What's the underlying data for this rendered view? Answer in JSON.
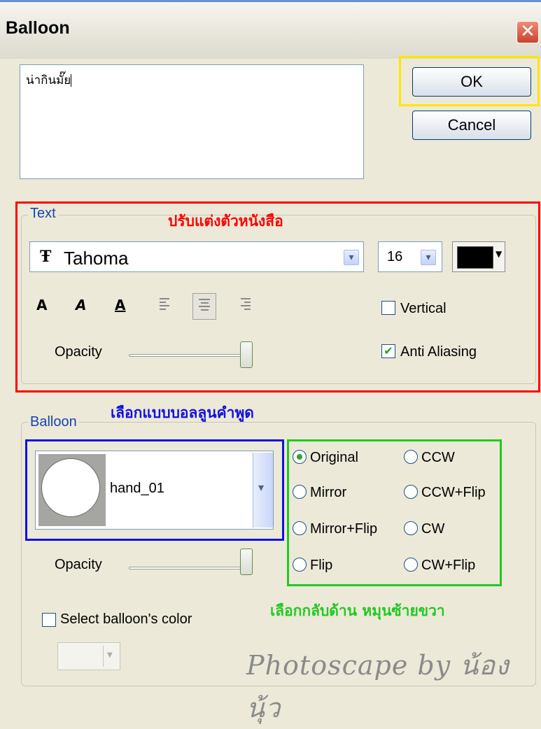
{
  "window": {
    "title": "Balloon",
    "close_glyph": "✕"
  },
  "message": {
    "value": "น่ากินมั๊ย"
  },
  "buttons": {
    "ok": "OK",
    "cancel": "Cancel"
  },
  "text_group": {
    "legend": "Text",
    "annotation": "ปรับแต่งตัวหนังสือ",
    "font_icon": "Ŧ",
    "font": "Tahoma",
    "size": "16",
    "color": "#000000",
    "bold": "A",
    "italic": "A",
    "underline": "A",
    "vertical_label": "Vertical",
    "vertical_checked": false,
    "anti_aliasing_label": "Anti Aliasing",
    "anti_aliasing_checked": true,
    "opacity_label": "Opacity",
    "opacity_level": 1.0
  },
  "balloon_group": {
    "legend": "Balloon",
    "annotation_style": "เลือกแบบบอลลูนคำพูด",
    "style_name": "hand_01",
    "opacity_label": "Opacity",
    "opacity_level": 1.0,
    "orientations": [
      "Original",
      "Mirror",
      "Mirror+Flip",
      "Flip",
      "CCW",
      "CCW+Flip",
      "CW",
      "CW+Flip"
    ],
    "selected_orientation": "Original",
    "annotation_orientation": "เลือกกลับด้าน หมุนซ้ายขวา",
    "select_color_label": "Select balloon's color",
    "select_color_checked": false
  },
  "watermark": "Photoscape by น้องนุ้ว",
  "colors": {
    "annot_red": "#ff0000",
    "annot_blue": "#1010e0",
    "annot_green": "#22c922",
    "annot_yellow": "#ffe600",
    "legend_blue": "#1744b4"
  },
  "icons": {
    "dropdown": "chevron-down-icon",
    "checkmark": "checkmark-icon"
  }
}
